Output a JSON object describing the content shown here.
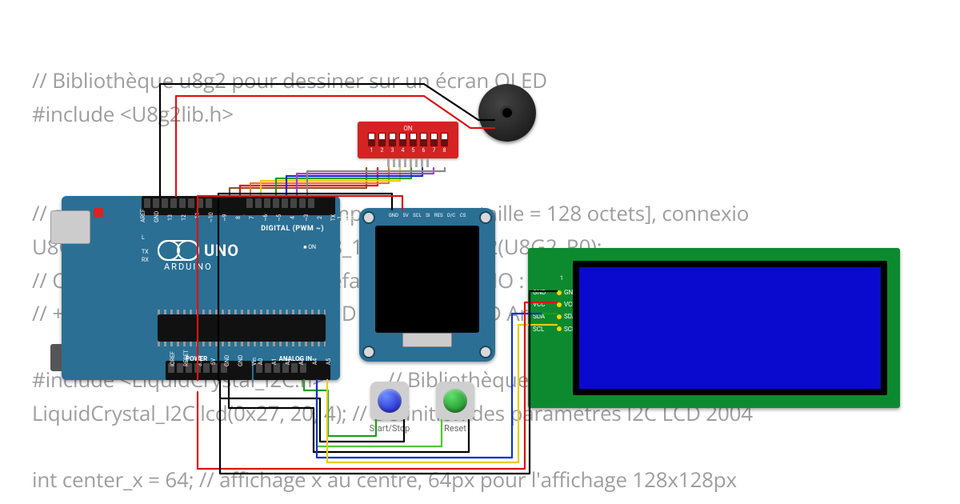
{
  "code_background": "// Bibliothèque u8g2 pour dessiner sur un écran OLED\n#include <U8g2lib.h>\n\n\n// affichage final 128x128 px [tampon de page, taille = 128 octets], connexio\nU8G2_SSD1327_MIDAS_128X128_1_HW_I2C u8g2(U8G2_R0);\n// Connexion I2C matériel par défaut Arduino UNO : SCL = A5 / SDA = A4\n// +5V OLED sur 5V Arduino / GND OLED sur GND Arduino connexion partagée\n\n#include <LiquidCrystal_I2C.h>            // Bibliothèque LiquidCrystal_I2C conn\nLiquidCrystal_I2C lcd(0x27, 20, 4); // Définition des paramètres I2C LCD 2004\n\nint center_x = 64; // affichage x au centre, 64px pour l'affichage 128x128px",
  "arduino": {
    "brand": "ARDUINO",
    "model": "UNO",
    "digital_section_label": "DIGITAL (PWM ~)",
    "power_section_label": "POWER",
    "analog_section_label": "ANALOG IN",
    "tx_label": "TX",
    "rx_label": "RX",
    "on_label": "ON",
    "l_label": "L",
    "pin_labels_top": [
      "AREF",
      "GND",
      "13",
      "12",
      "~11",
      "~10",
      "~9",
      "8",
      "7",
      "~6",
      "~5",
      "4",
      "~3",
      "2",
      "TX 1",
      "RX 0"
    ],
    "pin_labels_bottom_power": [
      "IOREF",
      "RESET",
      "3.3V",
      "5V",
      "GND",
      "GND",
      "Vin"
    ],
    "pin_labels_bottom_analog": [
      "A0",
      "A1",
      "A2",
      "A3",
      "A4",
      "A5"
    ]
  },
  "oled": {
    "pin_labels": [
      "GND",
      "5V",
      "SCL",
      "SI",
      "RES",
      "D/C",
      "CS"
    ]
  },
  "lcd": {
    "pin_labels_left": [
      "GND",
      "VCC",
      "SDA",
      "SCL"
    ],
    "pin_labels_right": [
      "GND",
      "VCC",
      "SDA",
      "SCL"
    ],
    "marker": "1"
  },
  "buttons": {
    "start_stop": {
      "label": "Start/Stop",
      "color": "#2030d0"
    },
    "reset": {
      "label": "Reset",
      "color": "#18a020"
    }
  },
  "dip_switch": {
    "on_label": "ON",
    "count": 8,
    "numbers": [
      "1",
      "2",
      "3",
      "4",
      "5",
      "6",
      "7",
      "8"
    ]
  },
  "wire_colors": {
    "black": "#000000",
    "red": "#e01010",
    "green": "#18a018",
    "yellow": "#eeca10",
    "blue": "#1030d0",
    "orange": "#f07818",
    "purple": "#a040d0",
    "brown": "#8a5a2a",
    "grey": "#888888",
    "limegreen": "#50c830"
  }
}
